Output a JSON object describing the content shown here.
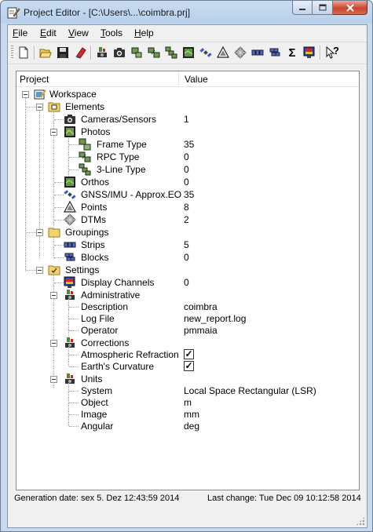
{
  "window": {
    "title": "Project Editor - [C:\\Users\\...\\coimbra.prj]",
    "colors": {
      "titlebar": "#b8d0ec",
      "close_button": "#c9452b",
      "folder": "#f5d36b"
    }
  },
  "menu": {
    "file": "ile",
    "file_mnemonic": "F",
    "edit": "dit",
    "edit_mnemonic": "E",
    "view": "iew",
    "view_mnemonic": "V",
    "tools": "ools",
    "tools_mnemonic": "T",
    "help": "elp",
    "help_mnemonic": "H"
  },
  "toolbar": {
    "icons": [
      "new-icon",
      "open-icon",
      "save-icon",
      "erase-icon",
      "camera-sensor-icon",
      "camera-icon",
      "frame-photo-icon",
      "rpc-photo-icon",
      "three-line-photo-icon",
      "ortho-icon",
      "gnss-imu-icon",
      "points-icon",
      "dtm-icon",
      "strips-icon",
      "blocks-icon",
      "sum-icon",
      "display-channels-icon",
      "help-pointer-icon"
    ],
    "sum_glyph": "Σ",
    "help_glyph": "?"
  },
  "tree": {
    "col_project": "Project",
    "col_value": "Value",
    "workspace": "Workspace",
    "elements": "Elements",
    "cameras_sensors": {
      "label": "Cameras/Sensors",
      "value": "1"
    },
    "photos": "Photos",
    "frame_type": {
      "label": "Frame Type",
      "value": "35"
    },
    "rpc_type": {
      "label": "RPC Type",
      "value": "0"
    },
    "three_line_type": {
      "label": "3-Line Type",
      "value": "0"
    },
    "orthos": {
      "label": "Orthos",
      "value": "0"
    },
    "gnss_imu": {
      "label": "GNSS/IMU - Approx.EO",
      "value": "35"
    },
    "points": {
      "label": "Points",
      "value": "8"
    },
    "dtms": {
      "label": "DTMs",
      "value": "2"
    },
    "groupings": "Groupings",
    "strips": {
      "label": "Strips",
      "value": "5"
    },
    "blocks": {
      "label": "Blocks",
      "value": "0"
    },
    "settings": "Settings",
    "display_channels": {
      "label": "Display Channels",
      "value": "0"
    },
    "administrative": "Administrative",
    "description": {
      "label": "Description",
      "value": "coimbra"
    },
    "log_file": {
      "label": "Log File",
      "value": "new_report.log"
    },
    "operator": {
      "label": "Operator",
      "value": "pmmaia"
    },
    "corrections": "Corrections",
    "atmospheric_refraction": {
      "label": "Atmospheric Refraction",
      "checked": true,
      "mark": "✓"
    },
    "earths_curvature": {
      "label": "Earth's Curvature",
      "checked": true,
      "mark": "✓"
    },
    "units": "Units",
    "system": {
      "label": "System",
      "value": "Local Space Rectangular (LSR)"
    },
    "object": {
      "label": "Object",
      "value": "m"
    },
    "image": {
      "label": "Image",
      "value": "mm"
    },
    "angular": {
      "label": "Angular",
      "value": "deg"
    }
  },
  "status": {
    "generation_date": "Generation date:  sex 5. Dez 12:43:59 2014",
    "last_change": "Last change:  Tue Dec 09 10:12:58 2014"
  }
}
